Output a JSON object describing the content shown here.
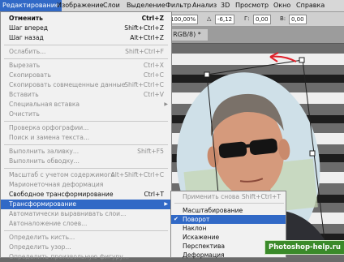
{
  "menubar": {
    "items": [
      {
        "label": "Редактирование"
      },
      {
        "label": "Изображение"
      },
      {
        "label": "Слои"
      },
      {
        "label": "Выделение"
      },
      {
        "label": "Фильтр"
      },
      {
        "label": "Анализ"
      },
      {
        "label": "3D"
      },
      {
        "label": "Просмотр"
      },
      {
        "label": "Окно"
      },
      {
        "label": "Справка"
      }
    ]
  },
  "options": {
    "zoom": "100,00%",
    "angle_symbol": "△",
    "angle": "-6,12",
    "h_label": "Г:",
    "h_value": "0,00",
    "v_label": "В:",
    "v_value": "0,00"
  },
  "document": {
    "tab_title": ", RGB/8) *"
  },
  "edit_menu": {
    "items": [
      {
        "label": "Отменить",
        "shortcut": "Ctrl+Z"
      },
      {
        "label": "Шаг вперед",
        "shortcut": "Shift+Ctrl+Z"
      },
      {
        "label": "Шаг назад",
        "shortcut": "Alt+Ctrl+Z"
      },
      {
        "label": "Ослабить...",
        "shortcut": "Shift+Ctrl+F"
      },
      {
        "label": "Вырезать",
        "shortcut": "Ctrl+X"
      },
      {
        "label": "Скопировать",
        "shortcut": "Ctrl+C"
      },
      {
        "label": "Скопировать совмещенные данные",
        "shortcut": "Shift+Ctrl+C"
      },
      {
        "label": "Вставить",
        "shortcut": "Ctrl+V"
      },
      {
        "label": "Специальная вставка",
        "shortcut": ""
      },
      {
        "label": "Очистить",
        "shortcut": ""
      },
      {
        "label": "Проверка орфографии...",
        "shortcut": ""
      },
      {
        "label": "Поиск и замена текста...",
        "shortcut": ""
      },
      {
        "label": "Выполнить заливку...",
        "shortcut": "Shift+F5"
      },
      {
        "label": "Выполнить обводку...",
        "shortcut": ""
      },
      {
        "label": "Масштаб с учетом содержимого",
        "shortcut": "Alt+Shift+Ctrl+C"
      },
      {
        "label": "Марионеточная деформация",
        "shortcut": ""
      },
      {
        "label": "Свободное трансформирование",
        "shortcut": "Ctrl+T"
      },
      {
        "label": "Трансформирование",
        "shortcut": ""
      },
      {
        "label": "Автоматически выравнивать слои...",
        "shortcut": ""
      },
      {
        "label": "Автоналожение слоев...",
        "shortcut": ""
      },
      {
        "label": "Определить кисть...",
        "shortcut": ""
      },
      {
        "label": "Определить узор...",
        "shortcut": ""
      },
      {
        "label": "Определить произвольную фигуру...",
        "shortcut": ""
      }
    ]
  },
  "transform_submenu": {
    "items": [
      {
        "label": "Применить снова",
        "shortcut": "Shift+Ctrl+T"
      },
      {
        "label": "Масштабирование",
        "shortcut": ""
      },
      {
        "label": "Поворот",
        "shortcut": "",
        "checked": true
      },
      {
        "label": "Наклон",
        "shortcut": ""
      },
      {
        "label": "Искажение",
        "shortcut": ""
      },
      {
        "label": "Перспектива",
        "shortcut": ""
      },
      {
        "label": "Деформация",
        "shortcut": ""
      }
    ],
    "check_mark": "✔"
  },
  "watermark": "Photoshop-help.ru",
  "colors": {
    "highlight": "#3169c6",
    "arrow_annotation": "#e0202a",
    "watermark_bg": "#3a8a2a"
  }
}
